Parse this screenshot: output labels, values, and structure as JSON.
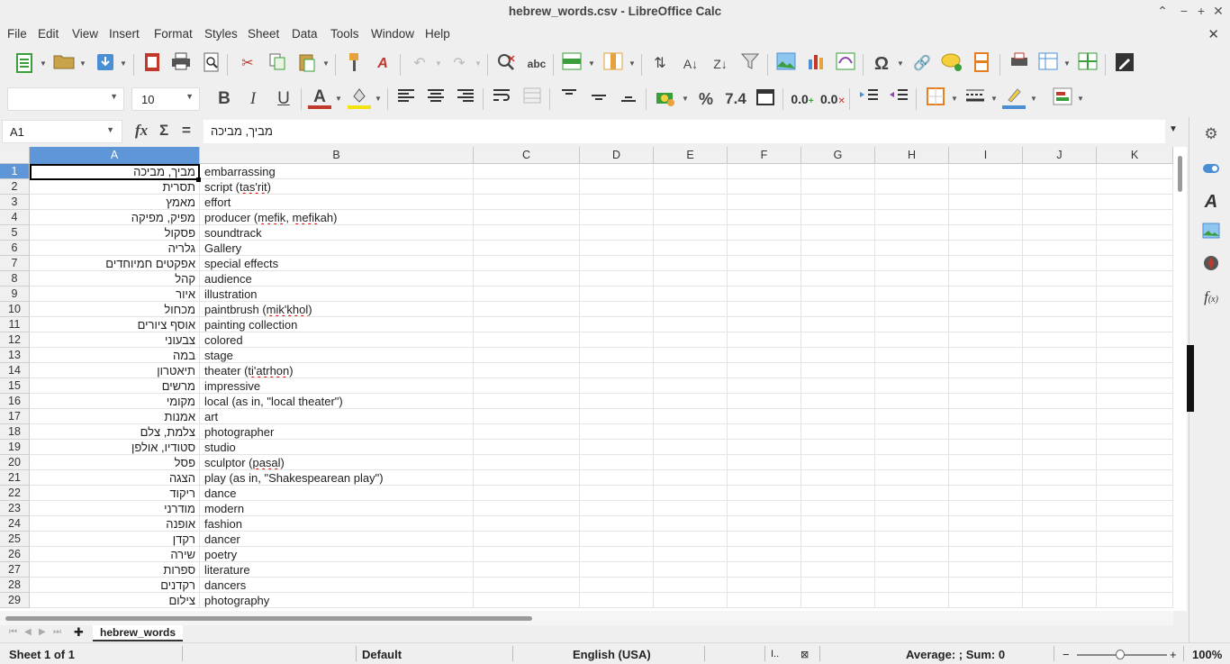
{
  "window": {
    "title": "hebrew_words.csv - LibreOffice Calc"
  },
  "menu": [
    "File",
    "Edit",
    "View",
    "Insert",
    "Format",
    "Styles",
    "Sheet",
    "Data",
    "Tools",
    "Window",
    "Help"
  ],
  "format_toolbar": {
    "font_name": "",
    "font_size": "10",
    "percent_label": "%",
    "number_label": "7.4",
    "decimal_add_label": "0.0",
    "decimal_remove_label": "0.0"
  },
  "formula_bar": {
    "cell_ref": "A1",
    "content": "מביך, מביכה"
  },
  "columns": [
    "A",
    "B",
    "C",
    "D",
    "E",
    "F",
    "G",
    "H",
    "I",
    "J",
    "K"
  ],
  "rows": [
    {
      "num": "1",
      "a": "מביך, מביכה",
      "b": "embarrassing"
    },
    {
      "num": "2",
      "a": "תסרית",
      "b": "script (tas'rit)"
    },
    {
      "num": "3",
      "a": "מאמץ",
      "b": "effort"
    },
    {
      "num": "4",
      "a": "מפיק, מפיקה",
      "b": "producer (mefik, mefikah)"
    },
    {
      "num": "5",
      "a": "פסקול",
      "b": "soundtrack"
    },
    {
      "num": "6",
      "a": "גלריה",
      "b": "Gallery"
    },
    {
      "num": "7",
      "a": "אפקטים חמיוחדים",
      "b": "special effects"
    },
    {
      "num": "8",
      "a": "קהל",
      "b": "audience"
    },
    {
      "num": "9",
      "a": "איור",
      "b": "illustration"
    },
    {
      "num": "10",
      "a": "מכחול",
      "b": "paintbrush (mik'khol)"
    },
    {
      "num": "11",
      "a": "אוסף ציורים",
      "b": "painting collection"
    },
    {
      "num": "12",
      "a": "צבעוני",
      "b": "colored"
    },
    {
      "num": "13",
      "a": "במה",
      "b": "stage"
    },
    {
      "num": "14",
      "a": "תיאטרון",
      "b": "theater (ti'atrhon)"
    },
    {
      "num": "15",
      "a": "מרשים",
      "b": "impressive"
    },
    {
      "num": "16",
      "a": "מקומי",
      "b": "local (as in, \"local theater\")"
    },
    {
      "num": "17",
      "a": "אמנות",
      "b": "art"
    },
    {
      "num": "18",
      "a": "צלמת, צלם",
      "b": "photographer"
    },
    {
      "num": "19",
      "a": "סטודיו, אולפן",
      "b": "studio"
    },
    {
      "num": "20",
      "a": "פסל",
      "b": "sculptor (pasal)"
    },
    {
      "num": "21",
      "a": "הצגה",
      "b": "play (as in, \"Shakespearean play\")"
    },
    {
      "num": "22",
      "a": "ריקוד",
      "b": "dance"
    },
    {
      "num": "23",
      "a": "מודרני",
      "b": "modern"
    },
    {
      "num": "24",
      "a": "אופנה",
      "b": "fashion"
    },
    {
      "num": "25",
      "a": "רקדן",
      "b": "dancer"
    },
    {
      "num": "26",
      "a": "שירה",
      "b": "poetry"
    },
    {
      "num": "27",
      "a": "ספרות",
      "b": "literature"
    },
    {
      "num": "28",
      "a": "רקדנים",
      "b": "dancers"
    },
    {
      "num": "29",
      "a": "צילום",
      "b": "photography"
    }
  ],
  "sheet_tab": "hebrew_words",
  "status": {
    "sheet": "Sheet 1 of 1",
    "page_style": "Default",
    "language": "English (USA)",
    "summary": "Average: ; Sum: 0",
    "zoom": "100%"
  },
  "colors": {
    "accent": "#5f96d8",
    "brand": "#3a9e3a"
  }
}
